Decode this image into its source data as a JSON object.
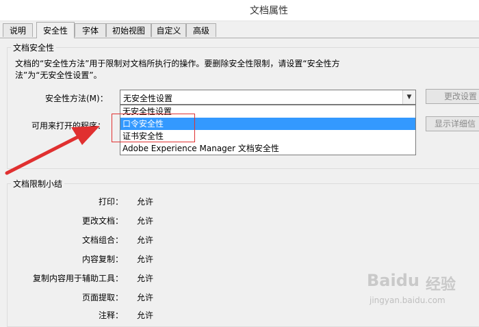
{
  "window": {
    "title": "文档属性"
  },
  "tabs": [
    {
      "label": "说明"
    },
    {
      "label": "安全性"
    },
    {
      "label": "字体"
    },
    {
      "label": "初始视图"
    },
    {
      "label": "自定义"
    },
    {
      "label": "高级"
    }
  ],
  "security": {
    "group_title": "文档安全性",
    "description": "文档的“安全性方法”用于限制对文档所执行的操作。要删除安全性限制，请设置“安全性方法”为“无安全性设置”。",
    "method_label": "安全性方法(M)：",
    "method_value": "无安全性设置",
    "open_with_label": "可用来打开的程序：",
    "change_settings_button": "更改设置",
    "show_details_button": "显示详细信",
    "dropdown_options": [
      {
        "label": "无安全性设置"
      },
      {
        "label": "口令安全性"
      },
      {
        "label": "证书安全性"
      },
      {
        "label": "Adobe Experience Manager 文档安全性"
      }
    ]
  },
  "summary": {
    "group_title": "文档限制小结",
    "rows": [
      {
        "label": "打印：",
        "value": "允许"
      },
      {
        "label": "更改文档：",
        "value": "允许"
      },
      {
        "label": "文档组合：",
        "value": "允许"
      },
      {
        "label": "内容复制：",
        "value": "允许"
      },
      {
        "label": "复制内容用于辅助工具：",
        "value": "允许"
      },
      {
        "label": "页面提取：",
        "value": "允许"
      },
      {
        "label": "注释：",
        "value": "允许"
      }
    ]
  },
  "watermark": {
    "brand": "Baidu",
    "suffix": "经验",
    "url": "jingyan.baidu.com"
  },
  "colors": {
    "selection": "#3399ff",
    "highlight_box": "#e03030"
  }
}
